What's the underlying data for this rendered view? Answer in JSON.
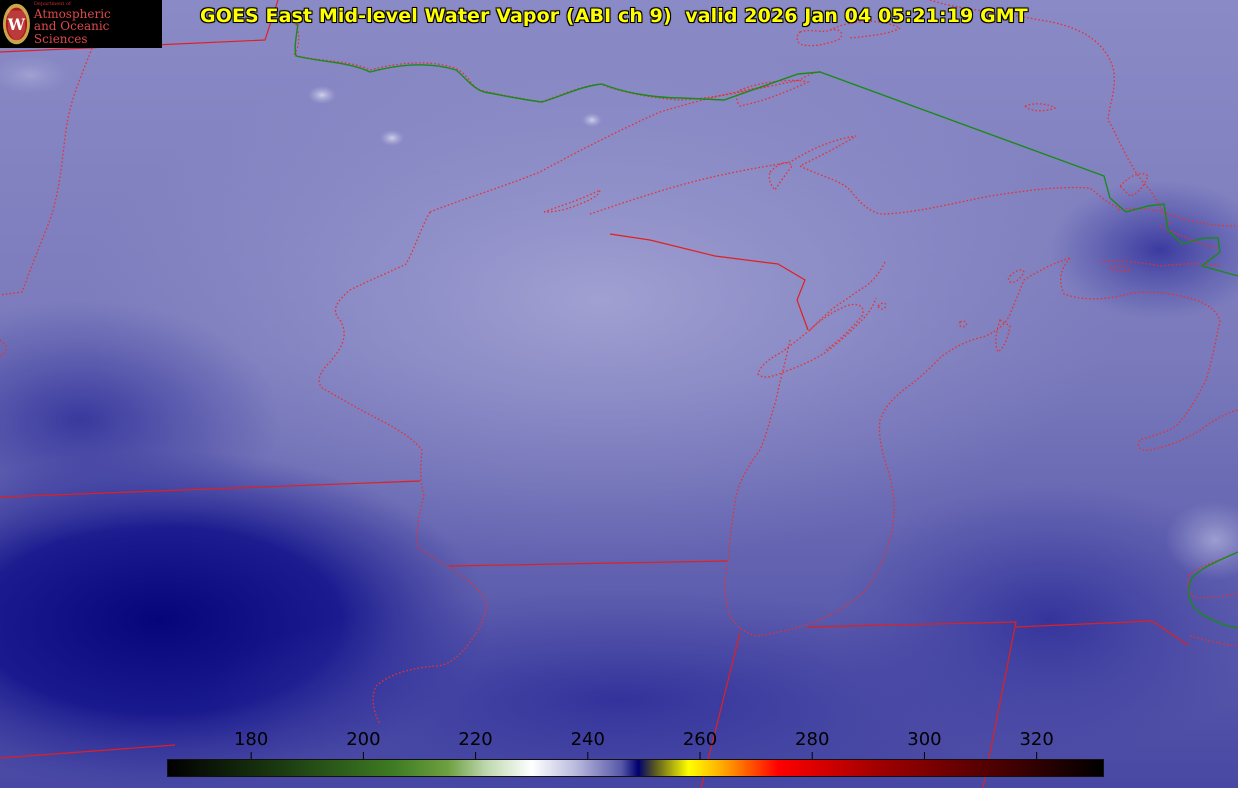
{
  "title": "GOES East Mid-level Water Vapor (ABI ch 9)  valid 2026 Jan 04 05:21:19 GMT",
  "logo": {
    "line1": "Department of",
    "line2": "Atmospheric",
    "line3": "and Oceanic Sciences",
    "seal_letter": "W"
  },
  "colorbar": {
    "ticks": [
      "180",
      "200",
      "220",
      "240",
      "260",
      "280",
      "300",
      "320"
    ],
    "tick_values": [
      180,
      200,
      220,
      240,
      260,
      280,
      300,
      320
    ],
    "min": 165,
    "max": 332,
    "stops": [
      {
        "v": 165,
        "c": "#000000"
      },
      {
        "v": 185,
        "c": "#1b3a10"
      },
      {
        "v": 205,
        "c": "#3d7a22"
      },
      {
        "v": 215,
        "c": "#6ea040"
      },
      {
        "v": 222,
        "c": "#c0d8b0"
      },
      {
        "v": 230,
        "c": "#ffffff"
      },
      {
        "v": 238,
        "c": "#b8b8dc"
      },
      {
        "v": 246,
        "c": "#5858a8"
      },
      {
        "v": 249,
        "c": "#000070"
      },
      {
        "v": 252,
        "c": "#5a5a20"
      },
      {
        "v": 258,
        "c": "#ffff00"
      },
      {
        "v": 264,
        "c": "#ffaa00"
      },
      {
        "v": 274,
        "c": "#ff0000"
      },
      {
        "v": 292,
        "c": "#a00000"
      },
      {
        "v": 312,
        "c": "#500000"
      },
      {
        "v": 332,
        "c": "#000000"
      }
    ]
  },
  "colors": {
    "state_border": "#e02020",
    "coastline": "#e83030",
    "intl_border": "#1a8a1a",
    "vapor_light": "#8e8ec8",
    "vapor_dark": "#0a0a80"
  }
}
